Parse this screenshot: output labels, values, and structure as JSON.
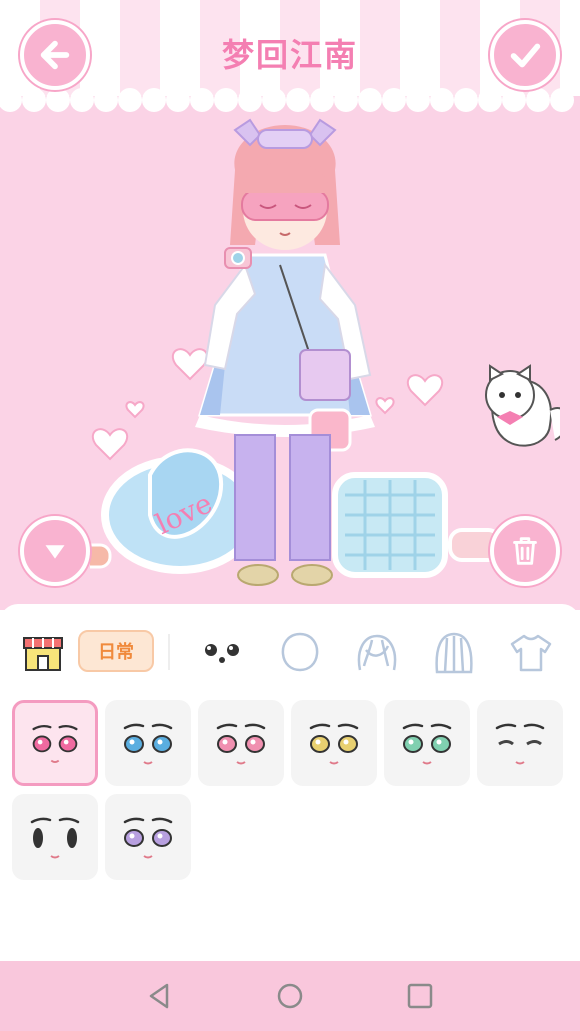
{
  "header": {
    "title": "梦回江南",
    "back_icon": "arrow-left-icon",
    "confirm_icon": "check-icon"
  },
  "scene": {
    "hide_panel_icon": "chevron-down-icon",
    "delete_icon": "trash-icon"
  },
  "toolbar": {
    "shop_icon": "shop-icon",
    "category_label": "日常",
    "tabs": [
      "face-features-icon",
      "head-shape-icon",
      "hair-front-icon",
      "hair-back-icon",
      "shirt-icon"
    ]
  },
  "faces": {
    "selected_index": 0,
    "items": [
      {
        "eye_color": "#f06aa0"
      },
      {
        "eye_color": "#5aaee0"
      },
      {
        "eye_color": "#f090b0"
      },
      {
        "eye_color": "#e8d070"
      },
      {
        "eye_color": "#80d0b0"
      },
      {
        "eye_color": "#444444"
      },
      {
        "eye_color": "#333333"
      },
      {
        "eye_color": "#b8a0e0"
      }
    ]
  },
  "navbar": {
    "back": "triangle-back-icon",
    "home": "circle-home-icon",
    "recents": "square-recents-icon"
  },
  "colors": {
    "scene_bg": "#fbd3e6",
    "accent_pink": "#f47fb2",
    "button_pink": "#f9b3d0",
    "category_orange": "#f08a3c",
    "navbar_pink": "#f9c7dc"
  }
}
